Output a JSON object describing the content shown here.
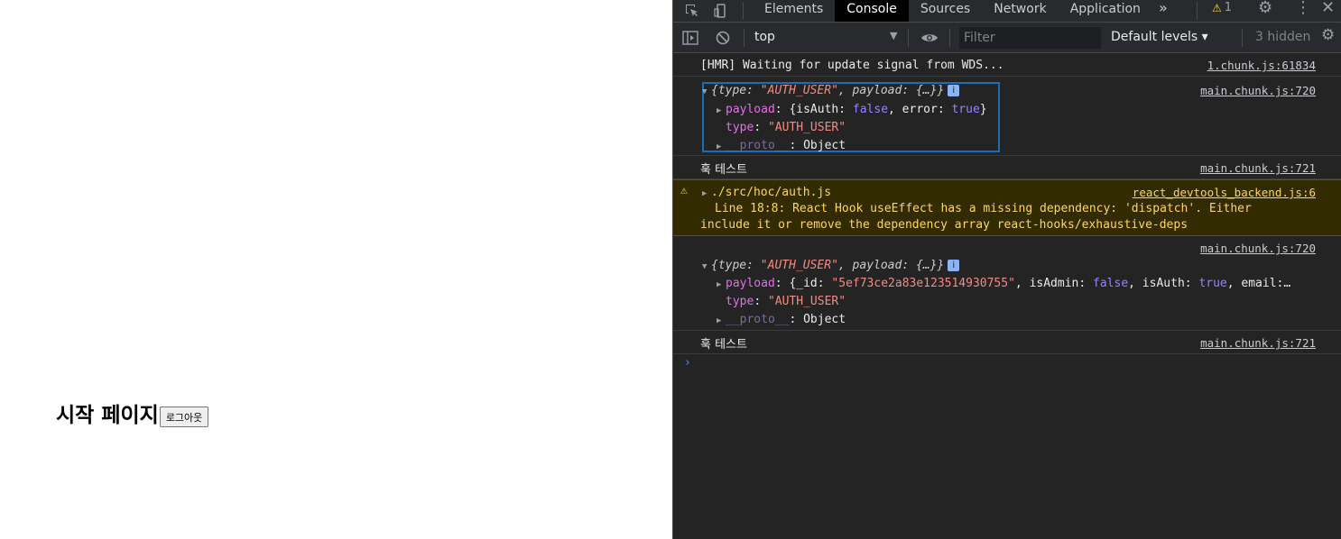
{
  "page": {
    "title": "시작 페이지",
    "logout_label": "로그아웃"
  },
  "devtools": {
    "tabs": [
      "Elements",
      "Console",
      "Sources",
      "Network",
      "Application"
    ],
    "active_tab": "Console",
    "more_tabs": "»",
    "warning_count": "1",
    "context": "top",
    "filter_placeholder": "Filter",
    "levels": "Default levels ▾",
    "hidden": "3 hidden",
    "messages": {
      "hmr": {
        "text": "[HMR] Waiting for update signal from WDS...",
        "source": "1.chunk.js:61834"
      },
      "obj1": {
        "source": "main.chunk.js:720",
        "summary_open": "{",
        "summary_type_key": "type: ",
        "summary_type_val": "\"AUTH_USER\"",
        "summary_rest": ", payload: {…}}",
        "payload_key": "payload",
        "payload_pre": ": {isAuth: ",
        "payload_auth": "false",
        "payload_mid": ", error: ",
        "payload_err": "true",
        "payload_end": "}",
        "type_key": "type",
        "type_val": "\"AUTH_USER\"",
        "proto_key": "__proto__",
        "proto_val": ": Object"
      },
      "hook1": {
        "text": "훅 테스트",
        "source": "main.chunk.js:721"
      },
      "warning": {
        "path": "./src/hoc/auth.js",
        "source": "react_devtools_backend.js:6",
        "line1": "Line 18:8:  React Hook useEffect has a missing dependency: 'dispatch'. Either",
        "line2": "include it or remove the dependency array  react-hooks/exhaustive-deps"
      },
      "obj2": {
        "source": "main.chunk.js:720",
        "summary_open": "{",
        "summary_type_key": "type: ",
        "summary_type_val": "\"AUTH_USER\"",
        "summary_rest": ", payload: {…}}",
        "payload_key": "payload",
        "payload_pre": ": {_id: ",
        "payload_id": "\"5ef73ce2a83e123514930755\"",
        "payload_mid": ", isAdmin: ",
        "payload_admin": "false",
        "payload_mid2": ", isAuth: ",
        "payload_auth": "true",
        "payload_end": ", email:…",
        "type_key": "type",
        "type_val": "\"AUTH_USER\"",
        "proto_key": "__proto__",
        "proto_val": ": Object"
      },
      "hook2": {
        "text": "훅 테스트",
        "source": "main.chunk.js:721"
      },
      "prompt": "›"
    }
  }
}
